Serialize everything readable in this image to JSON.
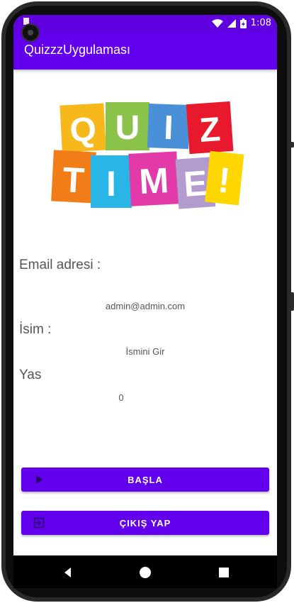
{
  "status_bar": {
    "time": "1:08"
  },
  "app_bar": {
    "title": "QuizzzUygulaması"
  },
  "logo": {
    "letters_row1": [
      "Q",
      "U",
      "I",
      "Z"
    ],
    "letters_row2": [
      "T",
      "I",
      "M",
      "E",
      "!"
    ]
  },
  "form": {
    "email_label": "Email adresi :",
    "email_value": "admin@admin.com",
    "name_label": "İsim :",
    "name_placeholder": "İsmini Gir",
    "age_label": "Yas",
    "age_value": "0"
  },
  "buttons": {
    "start_label": "BAŞLA",
    "exit_label": "ÇIKIŞ YAP"
  },
  "colors": {
    "primary": "#6200ee",
    "status": "#5e00e0"
  }
}
